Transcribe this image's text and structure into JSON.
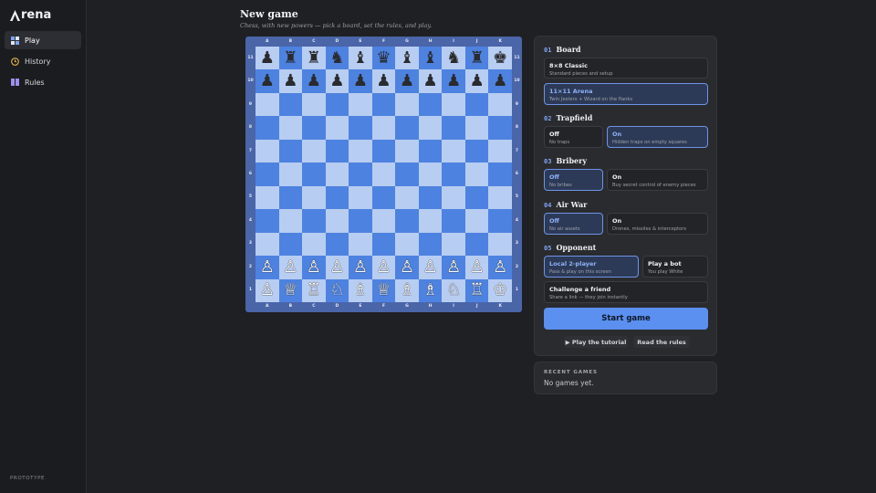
{
  "app": {
    "logo": "rena",
    "prototype_label": "PROTOTYPE"
  },
  "sidebar": {
    "items": [
      {
        "label": "Play",
        "icon": "play-squares-icon",
        "active": true
      },
      {
        "label": "History",
        "icon": "clock-icon",
        "active": false
      },
      {
        "label": "Rules",
        "icon": "book-icon",
        "active": false
      }
    ]
  },
  "header": {
    "title": "New game",
    "subtitle": "Chess, with new powers — pick a board, set the rules, and play."
  },
  "board": {
    "files": [
      "A",
      "B",
      "C",
      "D",
      "E",
      "F",
      "G",
      "H",
      "I",
      "J",
      "K"
    ],
    "ranks": [
      "11",
      "10",
      "9",
      "8",
      "7",
      "6",
      "5",
      "4",
      "3",
      "2",
      "1"
    ],
    "rank11": [
      "♟",
      "♜",
      "♜",
      "♞",
      "♝",
      "♛",
      "♝",
      "♝",
      "♞",
      "♜",
      "♚"
    ],
    "rank10": [
      "♟",
      "♟",
      "♟",
      "♟",
      "♟",
      "♟",
      "♟",
      "♟",
      "♟",
      "♟",
      "♟"
    ],
    "rank2": [
      "♙",
      "♙",
      "♙",
      "♙",
      "♙",
      "♙",
      "♙",
      "♙",
      "♙",
      "♙",
      "♙"
    ],
    "rank1": [
      "♙",
      "♕",
      "♖",
      "♘",
      "♗",
      "♕",
      "♗",
      "♗",
      "♘",
      "♖",
      "♔"
    ],
    "colors": {
      "light": "#b8cdf2",
      "dark": "#4d82e0",
      "frame": "#4a65a8"
    }
  },
  "settings": {
    "board": {
      "num": "01",
      "title": "Board",
      "options": [
        {
          "title": "8×8 Classic",
          "desc": "Standard pieces and setup"
        },
        {
          "title": "11×11 Arena",
          "desc": "Twin Jesters + Wizard on the flanks"
        }
      ]
    },
    "trapfield": {
      "num": "02",
      "title": "Trapfield",
      "options": [
        {
          "title": "Off",
          "desc": "No traps"
        },
        {
          "title": "On",
          "desc": "Hidden traps on empty squares"
        }
      ]
    },
    "bribery": {
      "num": "03",
      "title": "Bribery",
      "options": [
        {
          "title": "Off",
          "desc": "No bribes"
        },
        {
          "title": "On",
          "desc": "Buy secret control of enemy pieces"
        }
      ]
    },
    "airwar": {
      "num": "04",
      "title": "Air War",
      "options": [
        {
          "title": "Off",
          "desc": "No air assets"
        },
        {
          "title": "On",
          "desc": "Drones, missiles & interceptors"
        }
      ]
    },
    "opponent": {
      "num": "05",
      "title": "Opponent",
      "options": [
        {
          "title": "Local 2-player",
          "desc": "Pass & play on this screen"
        },
        {
          "title": "Play a bot",
          "desc": "You play White"
        },
        {
          "title": "Challenge a friend",
          "desc": "Share a link — they join instantly"
        }
      ]
    }
  },
  "actions": {
    "start": "Start game",
    "tutorial": "▶ Play the tutorial",
    "rules": "Read the rules"
  },
  "recent": {
    "heading": "RECENT GAMES",
    "empty": "No games yet."
  },
  "accent": "#5b8ff0"
}
